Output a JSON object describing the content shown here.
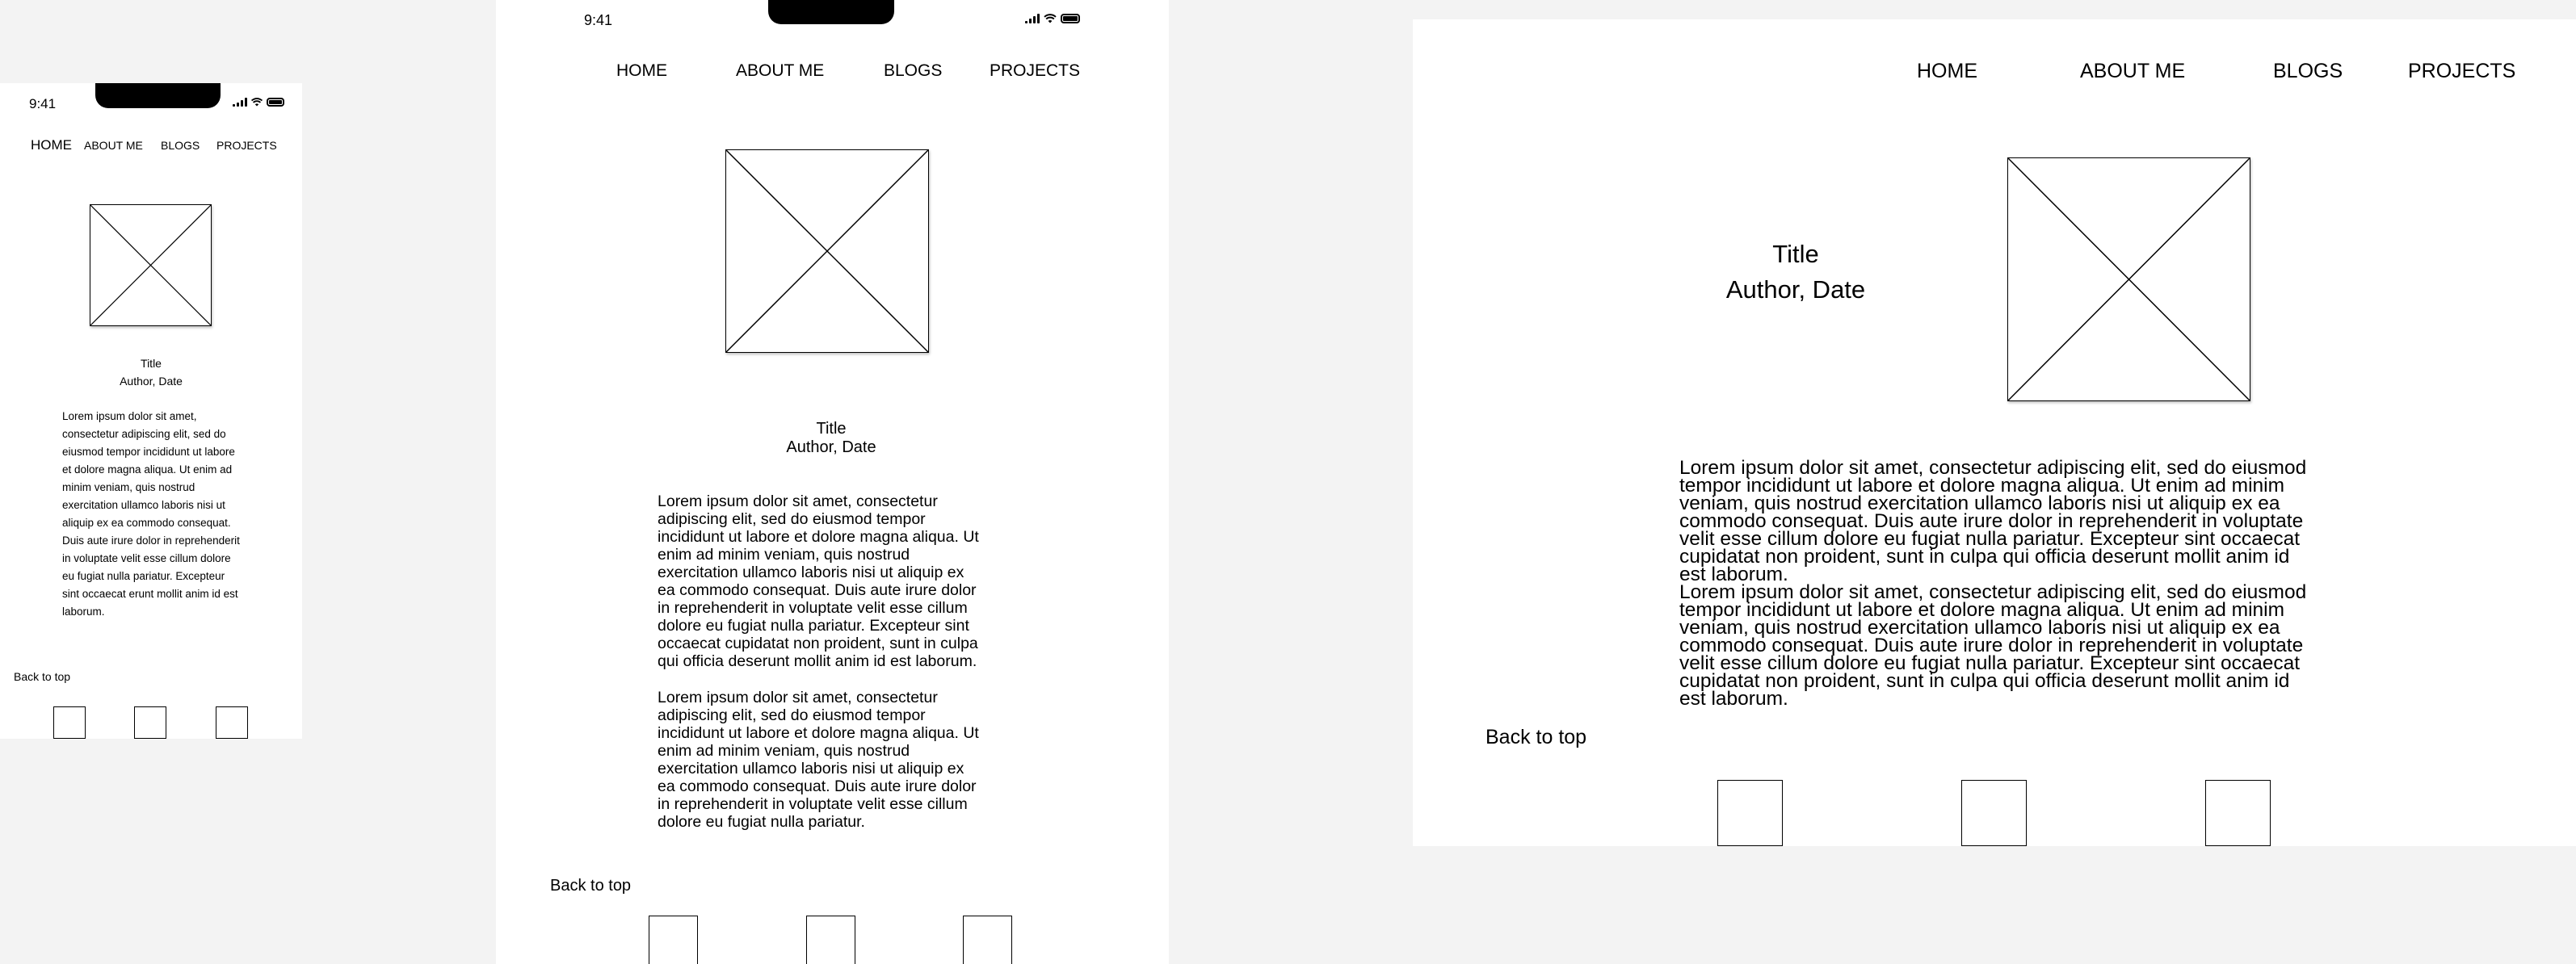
{
  "status": {
    "time": "9:41"
  },
  "nav": {
    "home": "HOME",
    "about": "ABOUT ME",
    "blogs": "BLOGS",
    "projects": "PROJECTS"
  },
  "post": {
    "title": "Title",
    "meta": "Author, Date"
  },
  "body": {
    "p_mobile": "Lorem ipsum dolor sit amet, consectetur adipiscing elit, sed do eiusmod tempor incididunt ut labore et dolore magna aliqua. Ut enim ad minim veniam, quis nostrud exercitation ullamco laboris nisi ut aliquip ex ea commodo consequat. Duis aute irure dolor in reprehenderit in voluptate velit esse cillum dolore eu fugiat nulla pariatur. Excepteur sint occaecat erunt mollit anim id est laborum.",
    "p1": "Lorem ipsum dolor sit amet, consectetur adipiscing elit, sed do eiusmod tempor incididunt ut labore et dolore magna aliqua. Ut enim ad minim veniam, quis nostrud exercitation ullamco laboris nisi ut aliquip ex ea commodo consequat. Duis aute irure dolor in reprehenderit in voluptate velit esse cillum dolore eu fugiat nulla pariatur. Excepteur sint occaecat cupidatat non proident, sunt in culpa qui officia deserunt mollit anim id est laborum.",
    "p2_tablet": "Lorem ipsum dolor sit amet, consectetur adipiscing elit, sed do eiusmod tempor incididunt ut labore et dolore magna aliqua. Ut enim ad minim veniam, quis nostrud exercitation ullamco laboris nisi ut aliquip ex ea commodo consequat. Duis aute irure dolor in reprehenderit in voluptate velit esse cillum dolore eu fugiat nulla pariatur."
  },
  "footer": {
    "back_to_top": "Back to top"
  }
}
